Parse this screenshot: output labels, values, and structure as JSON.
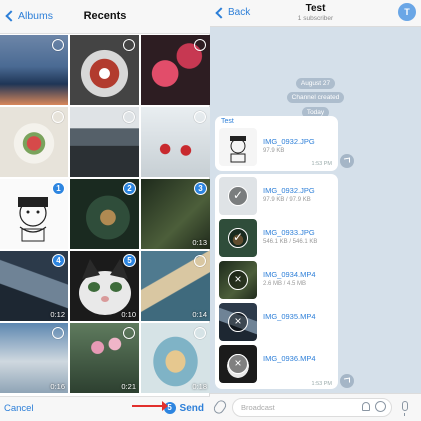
{
  "picker": {
    "back_label": "Albums",
    "title": "Recents",
    "cancel_label": "Cancel",
    "send_label": "Send",
    "selected_count": "5",
    "cells": [
      {
        "badge": "",
        "duration": ""
      },
      {
        "badge": "",
        "duration": ""
      },
      {
        "badge": "",
        "duration": ""
      },
      {
        "badge": "",
        "duration": ""
      },
      {
        "badge": "",
        "duration": ""
      },
      {
        "badge": "",
        "duration": ""
      },
      {
        "badge": "1",
        "duration": ""
      },
      {
        "badge": "2",
        "duration": ""
      },
      {
        "badge": "3",
        "duration": "0:13"
      },
      {
        "badge": "4",
        "duration": "0:12"
      },
      {
        "badge": "5",
        "duration": "0:10"
      },
      {
        "badge": "",
        "duration": "0:14"
      },
      {
        "badge": "",
        "duration": "0:16"
      },
      {
        "badge": "",
        "duration": "0:21"
      },
      {
        "badge": "",
        "duration": "0:18"
      }
    ]
  },
  "chat": {
    "back_label": "Back",
    "title": "Test",
    "subtitle": "1 subscriber",
    "avatar_letter": "T",
    "system_messages": [
      "August 27",
      "Channel created",
      "Today"
    ],
    "message1": {
      "channel": "Test",
      "file_name": "IMG_0932.JPG",
      "file_size": "97.9 KB",
      "time": "1:53 PM"
    },
    "message2": {
      "files": [
        {
          "name": "IMG_0932.JPG",
          "size": "97.9 KB / 97.9 KB"
        },
        {
          "name": "IMG_0933.JPG",
          "size": "546.1 KB / 546.1 KB"
        },
        {
          "name": "IMG_0934.MP4",
          "size": "2.6 MB / 4.5 MB"
        },
        {
          "name": "IMG_0935.MP4",
          "size": ""
        },
        {
          "name": "IMG_0936.MP4",
          "size": ""
        }
      ],
      "time": "1:53 PM"
    },
    "input_placeholder": "Broadcast"
  },
  "colors": {
    "accent": "#2d7fd8",
    "badge": "#2d85e0",
    "arrow": "#e2302d",
    "chat_bg": "#d5e0ea"
  },
  "icons": [
    "back-chevron-icon",
    "selection-circle-icon",
    "paperclip-icon",
    "bell-icon",
    "sticker-icon",
    "microphone-icon",
    "share-icon",
    "close-icon",
    "checkmark-icon"
  ]
}
